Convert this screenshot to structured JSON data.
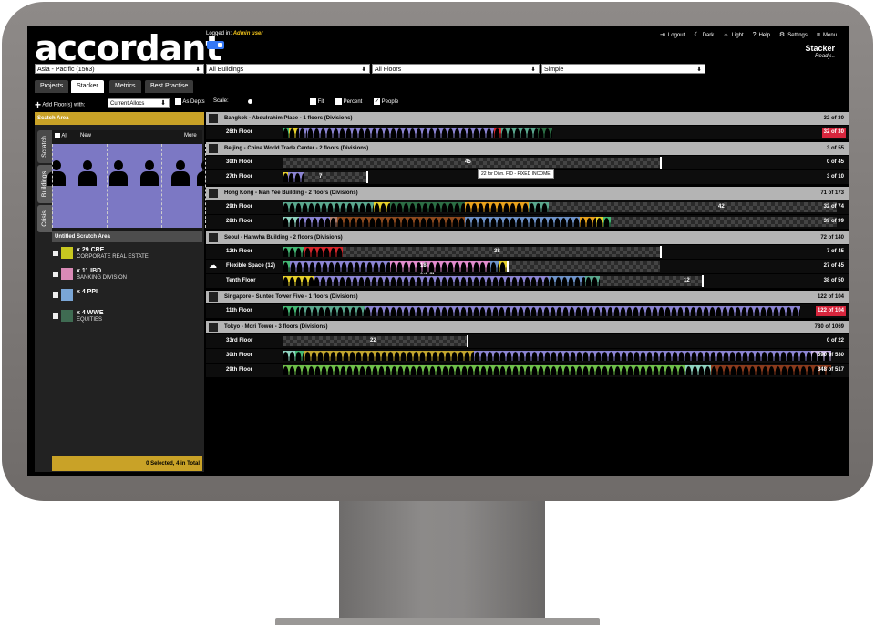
{
  "header": {
    "logo": "accordant",
    "logged_in_prefix": "Logged in:",
    "user": "Admin user",
    "nav": [
      {
        "icon": "logout-icon",
        "glyph": "⇥",
        "label": "Logout"
      },
      {
        "icon": "moon-icon",
        "glyph": "☾",
        "label": "Dark"
      },
      {
        "icon": "sun-icon",
        "glyph": "☼",
        "label": "Light"
      },
      {
        "icon": "help-icon",
        "glyph": "?",
        "label": "Help"
      },
      {
        "icon": "gear-icon",
        "glyph": "⚙",
        "label": "Settings"
      },
      {
        "icon": "hamburger-icon",
        "glyph": "≡",
        "label": "Menu"
      }
    ],
    "app_title": "Stacker",
    "app_status": "Ready..."
  },
  "filters": {
    "region": "Asia - Pacific (1563)",
    "buildings": "All Buildings",
    "floors": "All Floors",
    "mode": "Simple"
  },
  "tabs": [
    "Projects",
    "Stacker",
    "Metrics",
    "Best Practise"
  ],
  "active_tab": "Stacker",
  "toolbar": {
    "add_floor_label": "Add Floor(s) with:",
    "allocs_select": "Current Allocs",
    "as_depts": "As Depts",
    "scale_label": "Scale:",
    "fit": "Fit",
    "percent": "Percent",
    "people": "People"
  },
  "sidebar": {
    "scratch_area_title": "Scatch Area",
    "vtabs": [
      "Scratch",
      "Buildings",
      "Crisis"
    ],
    "all": "All",
    "new": "New",
    "more": "More",
    "untitled": "Untitled Scratch Area",
    "items": [
      {
        "count": "x 29 CRE",
        "name": "CORPORATE REAL ESTATE",
        "color": "#c8c820"
      },
      {
        "count": "x 11 IBD",
        "name": "BANKING DIVISION",
        "color": "#d98ab6"
      },
      {
        "count": "x 4 PPI",
        "name": "",
        "color": "#7aa6d6"
      },
      {
        "count": "x 4 WWE",
        "name": "EQUITIES",
        "color": "#3f6b52"
      }
    ],
    "footer": "0 Selected, 4 in Total"
  },
  "tooltip": "22 for Divn. FID - FIXED INCOME",
  "buildings": [
    {
      "name": "Bangkok - Abdulrahim Place - 1 floors (Divisions)",
      "count": "32 of 30",
      "floors": [
        {
          "name": "26th Floor",
          "count": "32 of 30",
          "over": true,
          "label": ""
        }
      ]
    },
    {
      "name": "Beijing - China World Trade Center - 2 floors (Divisions)",
      "count": "3 of 55",
      "floors": [
        {
          "name": "30th Floor",
          "count": "0 of 45",
          "over": false,
          "label": "45"
        },
        {
          "name": "27th Floor",
          "count": "3 of 10",
          "over": false,
          "label": "7"
        }
      ]
    },
    {
      "name": "Hong Kong - Man Yee Building - 2 floors (Divisions)",
      "count": "71 of 173",
      "floors": [
        {
          "name": "29th Floor",
          "count": "32 of 74",
          "over": false,
          "label": "42"
        },
        {
          "name": "28th Floor",
          "count": "39 of 99",
          "over": false,
          "label": ""
        }
      ]
    },
    {
      "name": "Seoul - Hanwha Building - 2 floors (Divisions)",
      "count": "72 of 140",
      "floors": [
        {
          "name": "12th Floor",
          "count": "7 of 45",
          "over": false,
          "label": "38"
        },
        {
          "name": "Flexible Space (12)",
          "count": "27 of 45",
          "over": false,
          "label": "18 (x1.2)"
        },
        {
          "name": "Tenth Floor",
          "count": "38 of 50",
          "over": false,
          "label": "12"
        }
      ]
    },
    {
      "name": "Singapore - Suntec Tower Five - 1 floors (Divisions)",
      "count": "122 of 104",
      "floors": [
        {
          "name": "11th Floor",
          "count": "122 of 104",
          "over": true,
          "label": ""
        }
      ]
    },
    {
      "name": "Tokyo - Mori Tower - 3 floors (Divisions)",
      "count": "780 of 1069",
      "floors": [
        {
          "name": "33rd Floor",
          "count": "0 of 22",
          "over": false,
          "label": "22"
        },
        {
          "name": "30th Floor",
          "count": "390 of 530",
          "over": false,
          "label": ""
        },
        {
          "name": "29th Floor",
          "count": "348 of 517",
          "over": false,
          "label": ""
        }
      ]
    }
  ]
}
